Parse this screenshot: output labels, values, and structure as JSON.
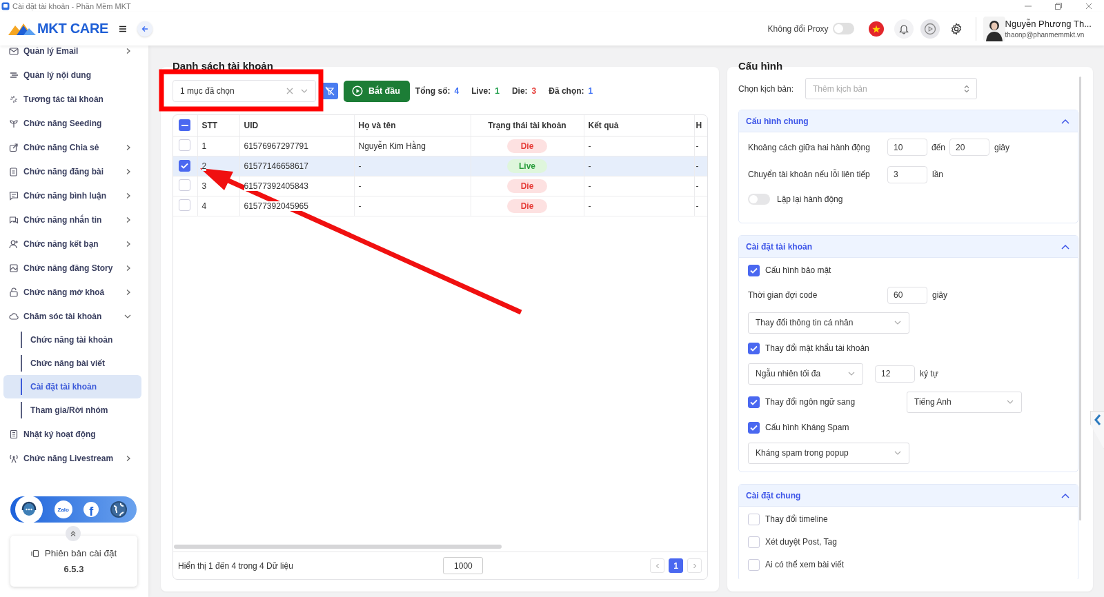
{
  "window": {
    "title": "Cài đặt tài khoản - Phần Mềm MKT"
  },
  "header": {
    "logo": "MKT CARE",
    "proxy": {
      "label": "Không đổi Proxy",
      "on": false
    },
    "user": {
      "name": "Nguyễn Phương Th...",
      "email": "thaonp@phanmemmkt.vn"
    }
  },
  "sidebar": {
    "items": [
      {
        "label": "Quản lý Email",
        "kind": "menu",
        "expanded": false
      },
      {
        "label": "Quản lý nội dung",
        "kind": "link"
      },
      {
        "label": "Tương tác tài khoản",
        "kind": "link"
      },
      {
        "label": "Chức năng Seeding",
        "kind": "link"
      },
      {
        "label": "Chức năng Chia sẻ",
        "kind": "menu",
        "expanded": false
      },
      {
        "label": "Chức năng đăng bài",
        "kind": "menu",
        "expanded": false
      },
      {
        "label": "Chức năng bình luận",
        "kind": "menu",
        "expanded": false
      },
      {
        "label": "Chức năng nhắn tin",
        "kind": "menu",
        "expanded": false
      },
      {
        "label": "Chức năng kết bạn",
        "kind": "menu",
        "expanded": false
      },
      {
        "label": "Chức năng đăng Story",
        "kind": "menu",
        "expanded": false
      },
      {
        "label": "Chức năng mở khoá",
        "kind": "menu",
        "expanded": false
      },
      {
        "label": "Chăm sóc tài khoản",
        "kind": "menu",
        "expanded": true,
        "children": [
          {
            "label": "Chức năng tài khoản",
            "selected": false
          },
          {
            "label": "Chức năng bài viết",
            "selected": false
          },
          {
            "label": "Cài đặt tài khoản",
            "selected": true
          },
          {
            "label": "Tham gia/Rời nhóm",
            "selected": false
          }
        ]
      },
      {
        "label": "Nhật ký hoạt động",
        "kind": "link"
      },
      {
        "label": "Chức năng Livestream",
        "kind": "menu",
        "expanded": false
      }
    ],
    "social": [
      {
        "kind": "support"
      },
      {
        "kind": "zalo",
        "label": "Zalo"
      },
      {
        "kind": "facebook",
        "label": "f"
      },
      {
        "kind": "web"
      }
    ],
    "version": {
      "label": "Phiên bản cài đặt",
      "number": "6.5.3"
    }
  },
  "accounts": {
    "title": "Danh sách tài khoản",
    "select": {
      "value": "1 mục đã chọn"
    },
    "start_button": "Bắt đầu",
    "stats": [
      {
        "label": "Tổng số:",
        "value": "4",
        "color": "#3b6ef5"
      },
      {
        "label": "Live:",
        "value": "1",
        "color": "#1e9e4a"
      },
      {
        "label": "Die:",
        "value": "3",
        "color": "#e53935"
      },
      {
        "label": "Đã chọn:",
        "value": "1",
        "color": "#3b6ef5"
      }
    ],
    "table": {
      "select_all": {
        "checked": true,
        "partial": true
      },
      "columns": [
        "STT",
        "UID",
        "Họ và tên",
        "Trạng thái tài khoản",
        "Kết quả",
        "H"
      ],
      "rows": [
        {
          "stt": "1",
          "uid": "61576967297791",
          "name": "Nguyễn Kim Hằng",
          "status": "Die",
          "alive": false,
          "result": "-",
          "column_6": "-",
          "selected": false
        },
        {
          "stt": "2",
          "uid": "61577146658617",
          "name": "-",
          "status": "Live",
          "alive": true,
          "result": "-",
          "column_6": "-",
          "selected": true
        },
        {
          "stt": "3",
          "uid": "61577392405843",
          "name": "-",
          "status": "Die",
          "alive": false,
          "result": "-",
          "column_6": "-",
          "selected": false
        },
        {
          "stt": "4",
          "uid": "61577392045965",
          "name": "-",
          "status": "Die",
          "alive": false,
          "result": "-",
          "column_6": "-",
          "selected": false
        }
      ]
    },
    "footer": {
      "summary": "Hiển thị 1 đến 4 trong 4 Dữ liệu",
      "page_size": "1000",
      "pages": [
        {
          "label": "1",
          "selected": true
        }
      ]
    }
  },
  "config": {
    "title": "Cấu hình",
    "script_label": "Chọn kịch bản:",
    "script_placeholder": "Thêm kịch bản",
    "sections": [
      {
        "title": "Cấu hình chung",
        "expanded": true,
        "rows": [
          {
            "kind": "range",
            "label": "Khoảng cách giữa hai hành động",
            "from": "10",
            "middle": "đến",
            "to": "20",
            "unit": "giây"
          },
          {
            "kind": "number",
            "label": "Chuyển tài khoản nếu lỗi liên tiếp",
            "value": "3",
            "unit": "lần"
          },
          {
            "kind": "toggle",
            "label": "Lặp lại hành động",
            "on": false
          }
        ]
      },
      {
        "title": "Cài đặt tài khoản",
        "expanded": true,
        "rows": [
          {
            "kind": "check",
            "label": "Cấu hình bảo mật",
            "checked": true
          },
          {
            "kind": "number",
            "label": "Thời gian đợi code",
            "value": "60",
            "unit": "giây"
          },
          {
            "kind": "select",
            "value": "Thay đổi thông tin cá nhân"
          },
          {
            "kind": "check",
            "label": "Thay đổi mật khẩu tài khoản",
            "checked": true
          },
          {
            "kind": "select_number",
            "value": "Ngẫu nhiên tối đa",
            "number": "12",
            "unit": "ký tự"
          },
          {
            "kind": "check_select",
            "label": "Thay đổi ngôn ngữ sang",
            "checked": true,
            "value": "Tiếng Anh"
          },
          {
            "kind": "check",
            "label": "Cấu hình Kháng Spam",
            "checked": true
          },
          {
            "kind": "select",
            "value": "Kháng spam trong popup"
          }
        ]
      },
      {
        "title": "Cài đặt chung",
        "expanded": true,
        "rows": [
          {
            "kind": "check",
            "label": "Thay đổi timeline",
            "checked": false
          },
          {
            "kind": "check",
            "label": "Xét duyệt Post, Tag",
            "checked": false
          },
          {
            "kind": "check",
            "label": "Ai có thể xem bài viết",
            "checked": false
          }
        ]
      }
    ]
  }
}
